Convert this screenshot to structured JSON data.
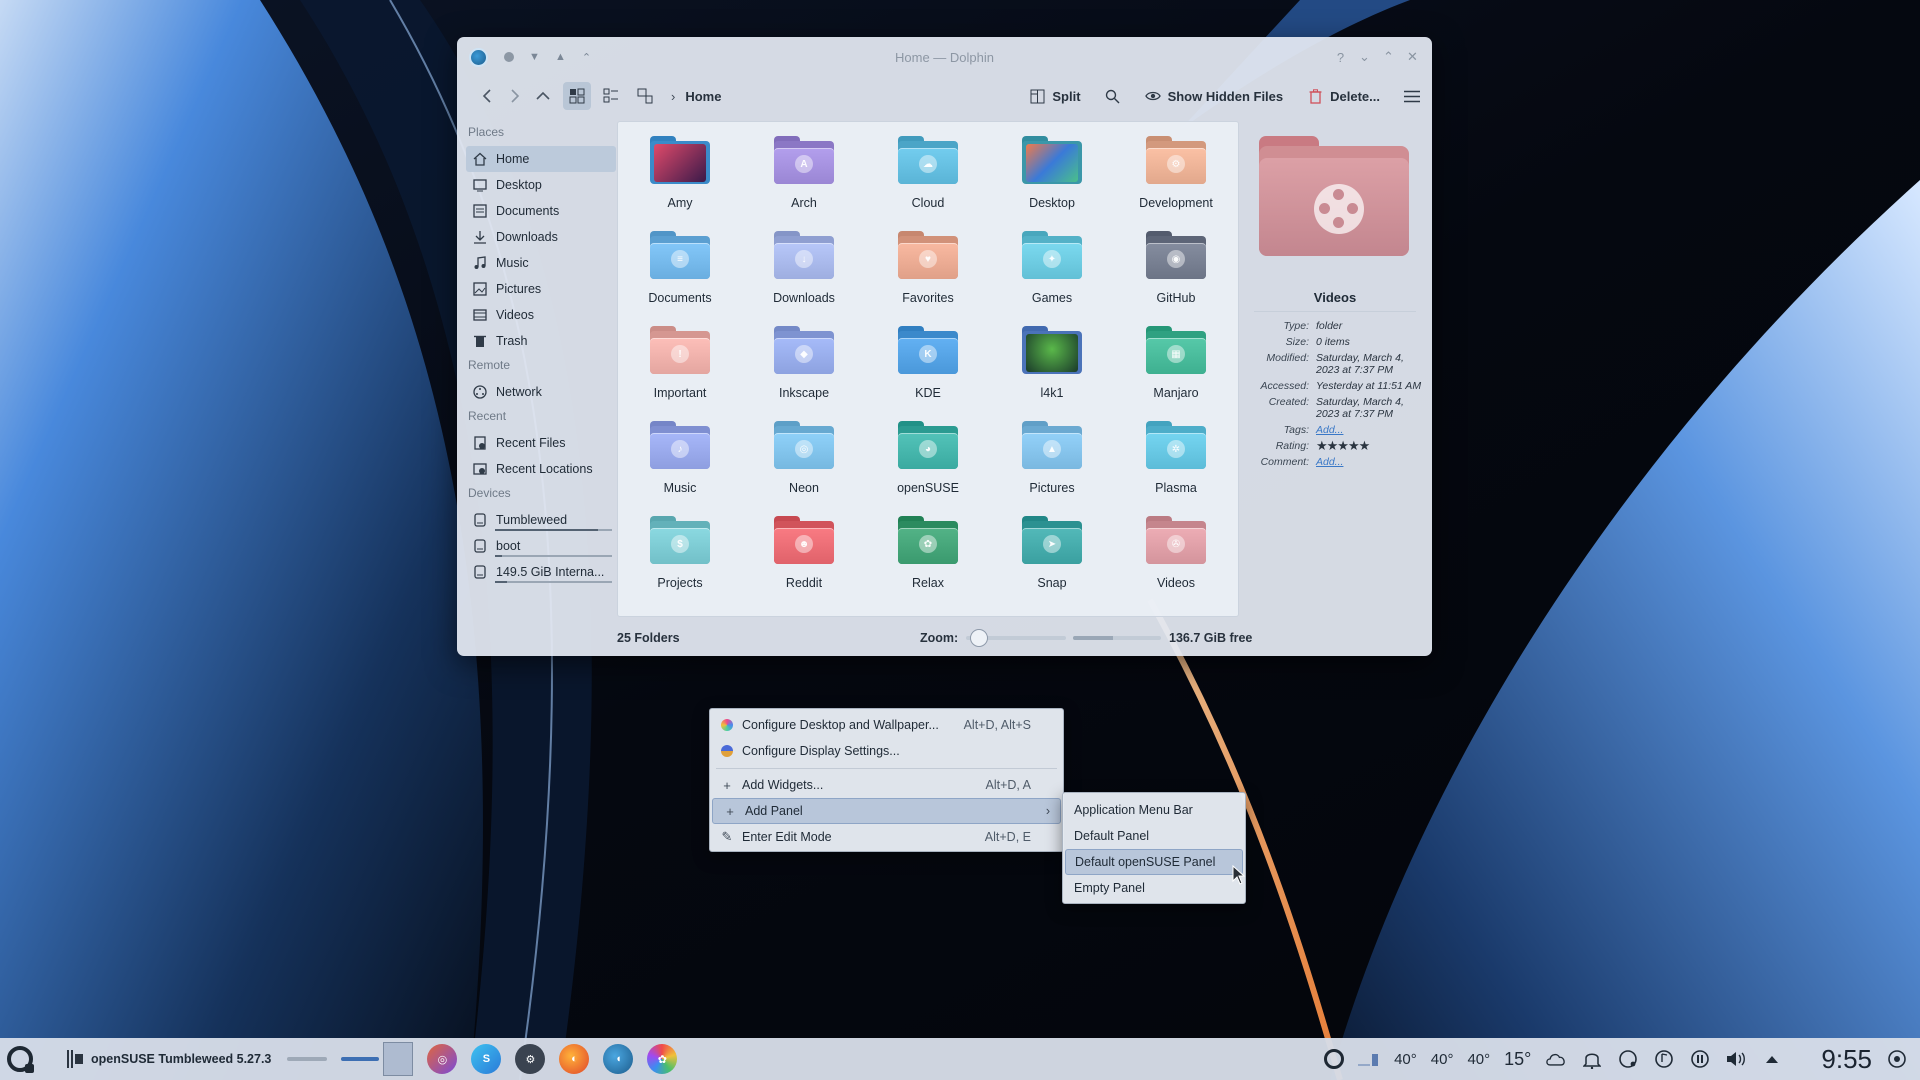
{
  "window": {
    "title": "Home — Dolphin",
    "breadcrumb": "Home",
    "toolbar": {
      "split_label": "Split",
      "show_hidden_label": "Show Hidden Files",
      "delete_label": "Delete..."
    }
  },
  "sidebar": {
    "sections": [
      {
        "heading": "Places",
        "items": [
          {
            "label": "Home",
            "icon": "home-icon",
            "active": true
          },
          {
            "label": "Desktop",
            "icon": "desktop-icon"
          },
          {
            "label": "Documents",
            "icon": "documents-icon"
          },
          {
            "label": "Downloads",
            "icon": "downloads-icon"
          },
          {
            "label": "Music",
            "icon": "music-icon"
          },
          {
            "label": "Pictures",
            "icon": "pictures-icon"
          },
          {
            "label": "Videos",
            "icon": "videos-icon"
          },
          {
            "label": "Trash",
            "icon": "trash-icon"
          }
        ]
      },
      {
        "heading": "Remote",
        "items": [
          {
            "label": "Network",
            "icon": "network-icon"
          }
        ]
      },
      {
        "heading": "Recent",
        "items": [
          {
            "label": "Recent Files",
            "icon": "recent-files-icon"
          },
          {
            "label": "Recent Locations",
            "icon": "recent-locations-icon"
          }
        ]
      },
      {
        "heading": "Devices",
        "items": [
          {
            "label": "Tumbleweed",
            "icon": "drive-icon",
            "usage": 0.88
          },
          {
            "label": "boot",
            "icon": "drive-icon",
            "usage": 0.06
          },
          {
            "label": "149.5 GiB Interna...",
            "icon": "drive-icon",
            "usage": 0.1
          }
        ]
      }
    ]
  },
  "folders": [
    {
      "label": "Amy",
      "color": "#4a9ad8",
      "emblem": "photo"
    },
    {
      "label": "Arch",
      "color": "#9a86d4",
      "emblem": "A"
    },
    {
      "label": "Cloud",
      "color": "#5ab4d6",
      "emblem": "☁"
    },
    {
      "label": "Desktop",
      "color": "#4aa6b8",
      "emblem": "photo"
    },
    {
      "label": "Development",
      "color": "#e2a88c",
      "emblem": "⚙"
    },
    {
      "label": "Documents",
      "color": "#6aaee0",
      "emblem": "≡"
    },
    {
      "label": "Downloads",
      "color": "#9eaee0",
      "emblem": "↓"
    },
    {
      "label": "Favorites",
      "color": "#e0a088",
      "emblem": "♥"
    },
    {
      "label": "Games",
      "color": "#62c0d6",
      "emblem": "✦"
    },
    {
      "label": "GitHub",
      "color": "#6c7486",
      "emblem": "◉"
    },
    {
      "label": "Important",
      "color": "#e4a6a0",
      "emblem": "!"
    },
    {
      "label": "Inkscape",
      "color": "#8da2e0",
      "emblem": "◆"
    },
    {
      "label": "KDE",
      "color": "#4a98da",
      "emblem": "K"
    },
    {
      "label": "l4k1",
      "color": "#5a82c8",
      "emblem": "photo"
    },
    {
      "label": "Manjaro",
      "color": "#3eb090",
      "emblem": "▦"
    },
    {
      "label": "Music",
      "color": "#8e9ee0",
      "emblem": "♪"
    },
    {
      "label": "Neon",
      "color": "#76b8e0",
      "emblem": "◎"
    },
    {
      "label": "openSUSE",
      "color": "#3aaaa0",
      "emblem": "◕"
    },
    {
      "label": "Pictures",
      "color": "#7ab8e0",
      "emblem": "▲"
    },
    {
      "label": "Plasma",
      "color": "#5cbcd8",
      "emblem": "✲"
    },
    {
      "label": "Projects",
      "color": "#72c0c8",
      "emblem": "$"
    },
    {
      "label": "Reddit",
      "color": "#e0626a",
      "emblem": "☻"
    },
    {
      "label": "Relax",
      "color": "#3a9a6e",
      "emblem": "✿"
    },
    {
      "label": "Snap",
      "color": "#3aa0a0",
      "emblem": "➤"
    },
    {
      "label": "Videos",
      "color": "#d4949c",
      "emblem": "✇"
    }
  ],
  "info_panel": {
    "name": "Videos",
    "rows": [
      {
        "key": "Type:",
        "value": "folder"
      },
      {
        "key": "Size:",
        "value": "0 items"
      },
      {
        "key": "Modified:",
        "value": "Saturday, March 4, 2023 at 7:37 PM"
      },
      {
        "key": "Accessed:",
        "value": "Yesterday at 11:51 AM"
      },
      {
        "key": "Created:",
        "value": "Saturday, March 4, 2023 at 7:37 PM"
      }
    ],
    "tags_key": "Tags:",
    "tags_link": "Add...",
    "rating_key": "Rating:",
    "rating_stars": "★★★★★",
    "comment_key": "Comment:",
    "comment_link": "Add..."
  },
  "statusbar": {
    "count": "25 Folders",
    "zoom_label": "Zoom:",
    "zoom_level": 0.05,
    "free_space": "136.7 GiB free",
    "used_fraction": 0.45
  },
  "context_menu": {
    "items": [
      {
        "label": "Configure Desktop and Wallpaper...",
        "shortcut": "Alt+D, Alt+S",
        "icon": "color-palette-icon"
      },
      {
        "label": "Configure Display Settings...",
        "shortcut": "",
        "icon": "display-icon"
      },
      {
        "label": "Add Widgets...",
        "shortcut": "Alt+D, A",
        "icon": "plus-icon"
      },
      {
        "label": "Add Panel",
        "shortcut": "",
        "icon": "plus-icon",
        "submenu": true
      },
      {
        "label": "Enter Edit Mode",
        "shortcut": "Alt+D, E",
        "icon": "edit-icon"
      }
    ],
    "submenu": [
      {
        "label": "Application Menu Bar"
      },
      {
        "label": "Default Panel"
      },
      {
        "label": "Default openSUSE Panel",
        "highlighted": true
      },
      {
        "label": "Empty Panel"
      }
    ]
  },
  "taskbar": {
    "task_title": "openSUSE Tumbleweed 5.27.3",
    "temps": [
      "40°",
      "40°",
      "40°"
    ],
    "weather_temp": "15°",
    "clock": "9:55"
  }
}
